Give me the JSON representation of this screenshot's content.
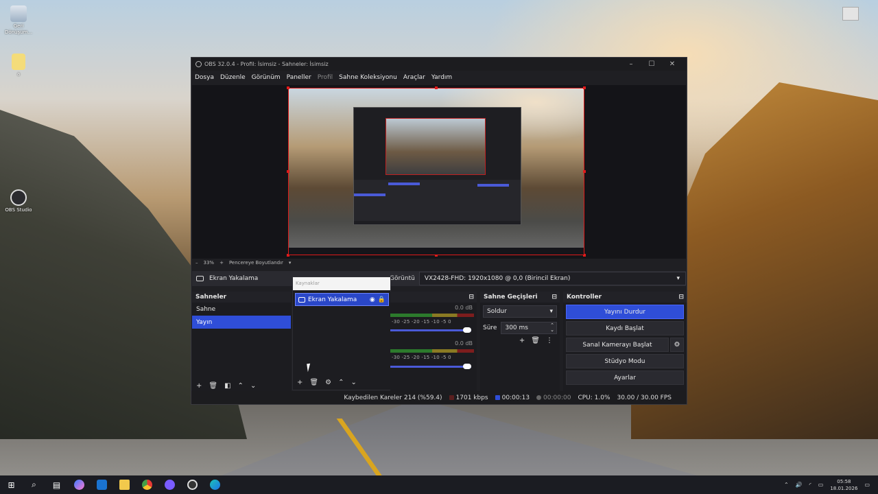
{
  "desktop": {
    "icons": [
      {
        "label": "Geri Dönüşüm...",
        "icon": "recycle-bin-icon"
      },
      {
        "label": "a",
        "icon": "folder-icon"
      },
      {
        "label": "OBS Studio",
        "icon": "obs-icon"
      }
    ]
  },
  "window": {
    "title": "OBS 32.0.4 - Profil: İsimsiz - Sahneler: İsimsiz",
    "menu": [
      "Dosya",
      "Düzenle",
      "Görünüm",
      "Paneller",
      "Profil",
      "Sahne Koleksiyonu",
      "Araçlar",
      "Yardım"
    ],
    "zoom": "33%",
    "zoom_fit": "Pencereye Boyutlandır",
    "source_name": "Ekran Yakalama",
    "display_label": "Görüntü",
    "display_value": "VX2428-FHD: 1920x1080 @ 0,0 (Birincil Ekran)"
  },
  "scenes": {
    "title": "Sahneler",
    "items": [
      "Sahne",
      "Yayın"
    ],
    "selected": 1
  },
  "sources": {
    "header": "Kaynaklar",
    "items": [
      {
        "label": "Ekran Yakalama"
      }
    ]
  },
  "mixer": {
    "tracks": [
      {
        "db": "0.0 dB",
        "scale": "-30 -25 -20 -15 -10 -5 0",
        "level": 0.95
      },
      {
        "db": "0.0 dB",
        "scale": "-30 -25 -20 -15 -10 -5 0",
        "level": 0.95
      }
    ]
  },
  "transitions": {
    "title": "Sahne Geçişleri",
    "type": "Soldur",
    "duration_label": "Süre",
    "duration": "300 ms"
  },
  "controls": {
    "title": "Kontroller",
    "stop_stream": "Yayını Durdur",
    "start_record": "Kaydı Başlat",
    "virtual_cam": "Sanal Kamerayı Başlat",
    "studio_mode": "Stüdyo Modu",
    "settings": "Ayarlar"
  },
  "status": {
    "dropped": "Kaybedilen Kareler 214 (%59.4)",
    "bitrate": "1701 kbps",
    "stream_time": "00:00:13",
    "rec_time": "00:00:00",
    "cpu": "CPU: 1.0%",
    "fps": "30.00 / 30.00 FPS"
  },
  "taskbar": {
    "time": "05:58",
    "date": "18.01.2026"
  },
  "colors": {
    "accent": "#2f4ed8",
    "preview_border": "#e01a1a"
  }
}
